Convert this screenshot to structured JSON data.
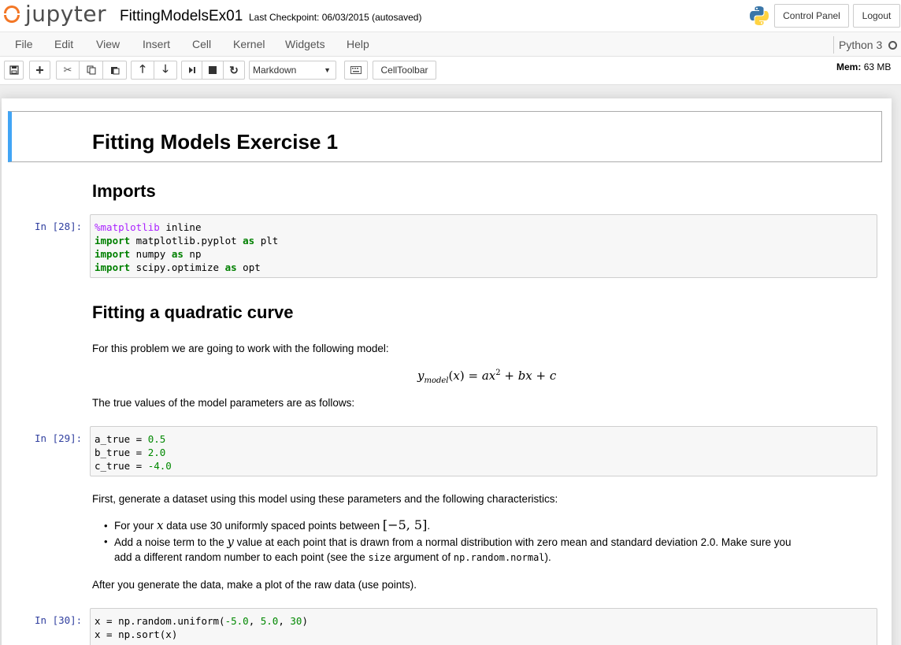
{
  "header": {
    "logo_text": "jupyter",
    "notebook_name": "FittingModelsEx01",
    "checkpoint": "Last Checkpoint: 06/03/2015 (autosaved)",
    "control_panel": "Control Panel",
    "logout": "Logout"
  },
  "menubar": {
    "items": [
      "File",
      "Edit",
      "View",
      "Insert",
      "Cell",
      "Kernel",
      "Widgets",
      "Help"
    ],
    "kernel": "Python 3"
  },
  "toolbar": {
    "cell_type": "Markdown",
    "celltoolbar": "CellToolbar",
    "mem_label": "Mem:",
    "mem_value": "63 MB"
  },
  "colors": {
    "accent_blue": "#42a5f5",
    "jupyter_orange": "#f37726",
    "prompt_blue": "#303f9f"
  },
  "cells": {
    "title": "Fitting Models Exercise 1",
    "imports_heading": "Imports",
    "prompt_28": "In [28]:",
    "prompt_29": "In [29]:",
    "prompt_30": "In [30]:",
    "quad_heading": "Fitting a quadratic curve",
    "intro_text": "For this problem we are going to work with the following model:",
    "true_values_text": "The true values of the model parameters are as follows:",
    "generate_text": "First, generate a dataset using this model using these parameters and the following characteristics:",
    "bullet1_pre": "For your ",
    "bullet1_var": "x",
    "bullet1_mid": " data use 30 uniformly spaced points between ",
    "bullet1_range": "[−5, 5]",
    "bullet1_post": ".",
    "bullet2_pre": "Add a noise term to the ",
    "bullet2_var": "y",
    "bullet2_mid": " value at each point that is drawn from a normal distribution with zero mean and standard deviation 2.0. Make sure you",
    "bullet2_line2_pre": "add a different random number to each point (see the ",
    "bullet2_code1": "size",
    "bullet2_line2_mid": " argument of ",
    "bullet2_code2": "np.random.normal",
    "bullet2_line2_post": ").",
    "after_text": "After you generate the data, make a plot of the raw data (use points)."
  }
}
